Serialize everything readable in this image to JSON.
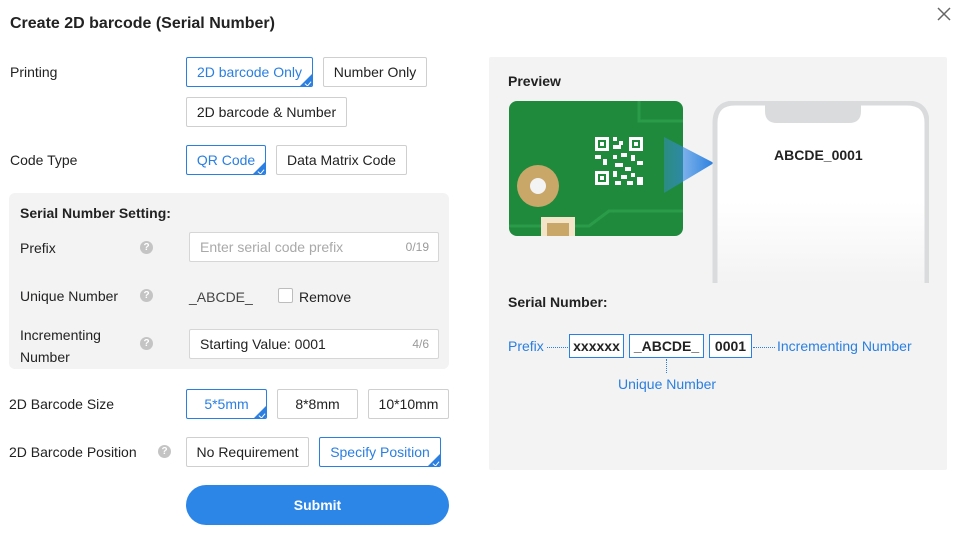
{
  "dialog": {
    "title": "Create 2D barcode (Serial Number)",
    "close_icon": "close-icon"
  },
  "printing": {
    "label": "Printing",
    "options": [
      "2D barcode Only",
      "Number Only",
      "2D barcode & Number"
    ],
    "selected": "2D barcode Only"
  },
  "code_type": {
    "label": "Code Type",
    "options": [
      "QR Code",
      "Data Matrix Code"
    ],
    "selected": "QR Code"
  },
  "serial_setting": {
    "heading": "Serial Number Setting:",
    "prefix": {
      "label": "Prefix",
      "placeholder": "Enter serial code prefix",
      "counter": "0/19"
    },
    "unique": {
      "label": "Unique Number",
      "value": "_ABCDE_",
      "remove_label": "Remove",
      "remove_checked": false
    },
    "incrementing": {
      "label": "Incrementing Number",
      "value": "Starting Value: 0001",
      "counter": "4/6"
    },
    "help_icon": "question-circle-icon",
    "help_glyph": "?"
  },
  "barcode_size": {
    "label": "2D Barcode Size",
    "options": [
      "5*5mm",
      "8*8mm",
      "10*10mm"
    ],
    "selected": "5*5mm"
  },
  "barcode_position": {
    "label": "2D Barcode Position",
    "options": [
      "No Requirement",
      "Specify Position"
    ],
    "selected": "Specify Position"
  },
  "submit_label": "Submit",
  "preview": {
    "title": "Preview",
    "phone_text": "ABCDE_0001",
    "serial_title": "Serial Number:",
    "prefix_label": "Prefix",
    "prefix_box": "xxxxxx",
    "unique_box": "_ABCDE_",
    "increment_box": "0001",
    "incrementing_label": "Incrementing Number",
    "unique_label": "Unique Number"
  },
  "colors": {
    "accent": "#2a7fe0",
    "submit": "#2b86e8",
    "pcb_green": "#1f8a3c",
    "panel_bg": "#f3f3f4"
  }
}
